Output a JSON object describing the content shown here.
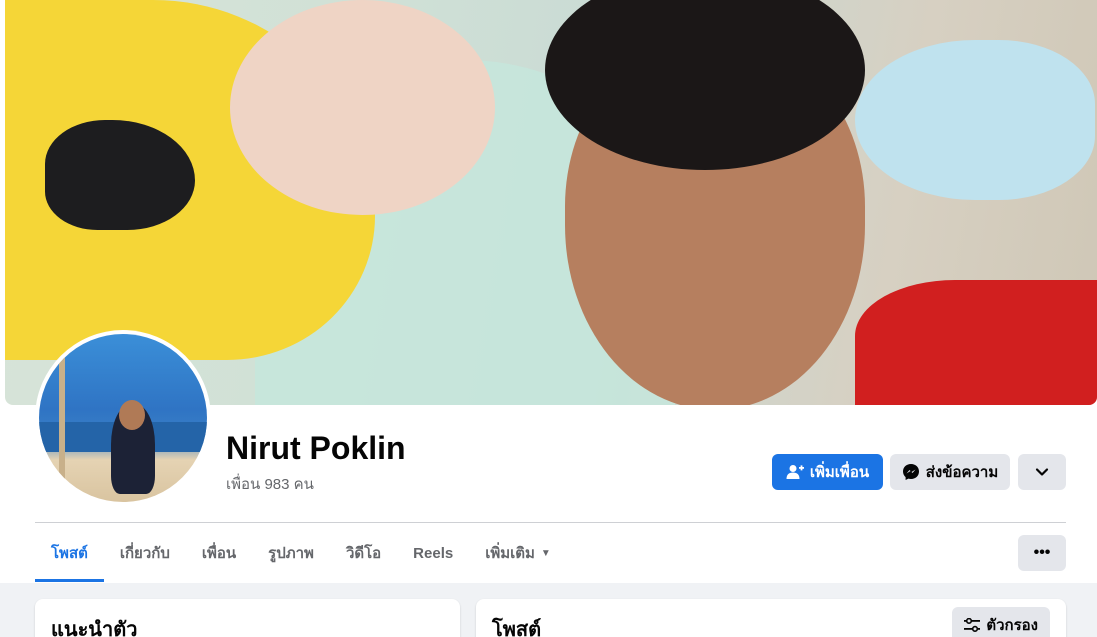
{
  "profile": {
    "name": "Nirut Poklin",
    "friends_text": "เพื่อน 983 คน"
  },
  "actions": {
    "add_friend_label": "เพิ่มเพื่อน",
    "message_label": "ส่งข้อความ",
    "more_icon": "chevron-down-icon"
  },
  "tabs": [
    {
      "label": "โพสต์",
      "active": true
    },
    {
      "label": "เกี่ยวกับ",
      "active": false
    },
    {
      "label": "เพื่อน",
      "active": false
    },
    {
      "label": "รูปภาพ",
      "active": false
    },
    {
      "label": "วิดีโอ",
      "active": false
    },
    {
      "label": "Reels",
      "active": false
    },
    {
      "label": "เพิ่มเติม",
      "active": false
    }
  ],
  "tab_menu_glyph": "•••",
  "intro": {
    "title": "แนะนำตัว"
  },
  "posts": {
    "title": "โพสต์",
    "filter_label": "ตัวกรอง"
  },
  "colors": {
    "accent": "#1b74e4",
    "secondary_button": "#e4e6eb",
    "muted_text": "#65676b"
  }
}
